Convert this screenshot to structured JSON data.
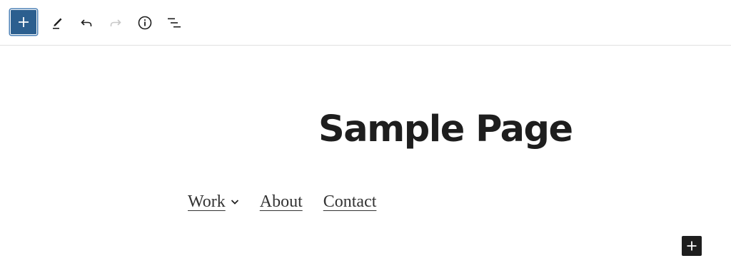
{
  "toolbar": {
    "buttons": [
      {
        "name": "block-inserter",
        "icon": "plus-icon",
        "state": "active"
      },
      {
        "name": "tools",
        "icon": "pencil-icon"
      },
      {
        "name": "undo",
        "icon": "undo-icon"
      },
      {
        "name": "redo",
        "icon": "redo-icon",
        "state": "disabled"
      },
      {
        "name": "details",
        "icon": "info-icon"
      },
      {
        "name": "document-overview",
        "icon": "list-view-icon"
      }
    ],
    "accent_color": "#2c5f8f"
  },
  "page": {
    "title": "Sample Page"
  },
  "navigation": {
    "items": [
      {
        "label": "Work",
        "has_submenu": true
      },
      {
        "label": "About"
      },
      {
        "label": "Contact"
      }
    ]
  },
  "canvas": {
    "inserter_icon": "plus-icon",
    "inserter_color": "#1e1e1e"
  }
}
